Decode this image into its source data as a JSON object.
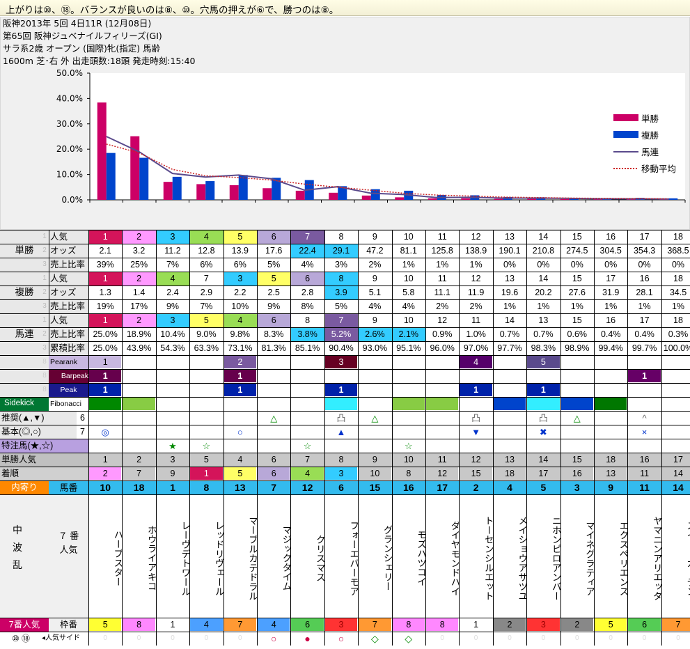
{
  "top_message": "上がりは⑩、⑱。バランスが良いのは⑧、⑩。穴馬の押えが⑥で、勝つのは⑧。",
  "race": {
    "line1": "阪神2013年 5回 4日11R (12月08日)",
    "line2": "第65回 阪神ジュベナイルフィリーズ(GI)",
    "line3": "サラ系2歳 オープン (国際)牝(指定) 馬齢",
    "line4": "1600m 芝･右 外 出走頭数:18頭 発走時刻:15:40"
  },
  "chart_data": {
    "type": "bar",
    "categories": [
      "1",
      "2",
      "3",
      "4",
      "5",
      "6",
      "7",
      "8",
      "9",
      "10",
      "11",
      "12",
      "13",
      "14",
      "15",
      "16",
      "17",
      "18"
    ],
    "ylim": [
      0,
      50
    ],
    "yticks": [
      "0.0%",
      "10.0%",
      "20.0%",
      "30.0%",
      "40.0%",
      "50.0%"
    ],
    "series": [
      {
        "name": "単勝",
        "type": "bar",
        "color": "#cc0066",
        "values": [
          38.4,
          25.1,
          7.1,
          6.2,
          5.8,
          4.6,
          3.6,
          2.8,
          1.7,
          1.0,
          0.6,
          0.6,
          0.4,
          0.4,
          0.3,
          0.3,
          0.2,
          0.2
        ]
      },
      {
        "name": "複勝",
        "type": "bar",
        "color": "#0044cc",
        "values": [
          18.5,
          16.6,
          9.1,
          7.4,
          9.8,
          8.7,
          7.8,
          5.4,
          4.2,
          3.6,
          1.9,
          1.8,
          1.1,
          1.0,
          0.8,
          0.7,
          0.8,
          0.6
        ]
      },
      {
        "name": "馬連",
        "type": "line",
        "color": "#5a4a8c",
        "values": [
          25.0,
          18.9,
          10.4,
          9.0,
          9.8,
          8.3,
          3.8,
          5.2,
          2.6,
          2.1,
          0.9,
          1.0,
          0.7,
          0.7,
          0.6,
          0.4,
          0.4,
          0.3
        ]
      },
      {
        "name": "移動平均",
        "type": "dotted",
        "color": "#cc2222",
        "values": [
          22.0,
          18.5,
          12.0,
          9.5,
          8.8,
          7.8,
          6.2,
          5.0,
          3.8,
          2.6,
          1.9,
          1.5,
          1.1,
          0.9,
          0.7,
          0.6,
          0.5,
          0.4
        ]
      }
    ]
  },
  "headers": {
    "tansho": "単勝",
    "fukusho": "複勝",
    "umaren": "馬連",
    "ninki": "人気",
    "odds": "オッズ",
    "uriage": "売上比率",
    "ruiseki": "累積比率",
    "pearank": "Pearank",
    "barpeak": "Barpeak",
    "peak": "Peak",
    "sidekick": "Sidekick",
    "fibonacci": "Fibonacci",
    "suisen": "推奨(▲,▼)",
    "suisen_n": "6",
    "kihon": "基本(◎,○)",
    "kihon_n": "7",
    "tokuchu": "特注馬(★,☆)",
    "tansho_ninki": "単勝人気",
    "chakujun": "着順",
    "uchiyori": "内寄り",
    "umaban": "馬番",
    "pattern1": "中",
    "pattern2": "波",
    "pattern3": "乱",
    "pattern_sub1": "７ 番",
    "pattern_sub2": "人気",
    "footer_left": "7番人気",
    "wakuban": "枠番",
    "popular_side_marks": "⑩ ⑱",
    "popular_side": "◂人気サイド",
    "row_fade1": "1",
    "row_fade2": "2",
    "row_fade3": "3"
  },
  "colors": {
    "magenta": "#d4145a",
    "pink": "#ff99ff",
    "cyan": "#33ccff",
    "green": "#99dd55",
    "yellow": "#ffff66",
    "lavender": "#b8a8d8",
    "purple": "#7a5aa0",
    "orange": "#ff9933",
    "darkpurple": "#66004c",
    "navy": "#0a1a8c",
    "blue": "#0033cc"
  },
  "tansho": {
    "ninki": [
      "1",
      "2",
      "3",
      "4",
      "5",
      "6",
      "7",
      "8",
      "9",
      "10",
      "11",
      "12",
      "13",
      "14",
      "15",
      "16",
      "17",
      "18"
    ],
    "odds": [
      "2.1",
      "3.2",
      "11.2",
      "12.8",
      "13.9",
      "17.6",
      "22.4",
      "29.1",
      "47.2",
      "81.1",
      "125.8",
      "138.9",
      "190.1",
      "210.8",
      "274.5",
      "304.5",
      "354.3",
      "368.5"
    ],
    "ratio": [
      "39%",
      "25%",
      "7%",
      "6%",
      "6%",
      "5%",
      "4%",
      "3%",
      "2%",
      "1%",
      "1%",
      "1%",
      "0%",
      "0%",
      "0%",
      "0%",
      "0%",
      "0%"
    ]
  },
  "fukusho": {
    "ninki": [
      "1",
      "2",
      "4",
      "7",
      "3",
      "5",
      "6",
      "8",
      "9",
      "10",
      "11",
      "12",
      "13",
      "14",
      "15",
      "17",
      "16",
      "18"
    ],
    "odds": [
      "1.3",
      "1.4",
      "2.4",
      "2.9",
      "2.2",
      "2.5",
      "2.8",
      "3.9",
      "5.1",
      "5.8",
      "11.1",
      "11.9",
      "19.6",
      "20.2",
      "27.6",
      "31.9",
      "28.1",
      "34.5"
    ],
    "ratio": [
      "19%",
      "17%",
      "9%",
      "7%",
      "10%",
      "9%",
      "8%",
      "5%",
      "4%",
      "4%",
      "2%",
      "2%",
      "1%",
      "1%",
      "1%",
      "1%",
      "1%",
      "1%"
    ]
  },
  "umaren": {
    "ninki": [
      "1",
      "2",
      "3",
      "5",
      "4",
      "6",
      "8",
      "7",
      "9",
      "10",
      "12",
      "11",
      "14",
      "13",
      "15",
      "16",
      "17",
      "18"
    ],
    "ratio": [
      "25.0%",
      "18.9%",
      "10.4%",
      "9.0%",
      "9.8%",
      "8.3%",
      "3.8%",
      "5.2%",
      "2.6%",
      "2.1%",
      "0.9%",
      "1.0%",
      "0.7%",
      "0.7%",
      "0.6%",
      "0.4%",
      "0.4%",
      "0.3%"
    ],
    "cumulative": [
      "25.0%",
      "43.9%",
      "54.3%",
      "63.3%",
      "73.1%",
      "81.3%",
      "85.1%",
      "90.4%",
      "93.0%",
      "95.1%",
      "96.0%",
      "97.0%",
      "97.7%",
      "98.3%",
      "98.9%",
      "99.4%",
      "99.7%",
      "100.0%"
    ]
  },
  "indicators": {
    "pearank": [
      "1",
      "",
      "",
      "",
      "2",
      "",
      "",
      "3",
      "",
      "",
      "",
      "4",
      "",
      "5",
      "",
      "",
      "",
      ""
    ],
    "barpeak": [
      "1",
      "",
      "",
      "",
      "1",
      "",
      "",
      "",
      "",
      "",
      "",
      "",
      "",
      "",
      "",
      "",
      "1",
      ""
    ],
    "peak": [
      "1",
      "",
      "",
      "",
      "1",
      "",
      "",
      "1",
      "",
      "",
      "",
      "1",
      "",
      "1",
      "",
      "",
      "",
      ""
    ]
  },
  "marks": {
    "suisen": [
      "",
      "",
      "",
      "",
      "",
      "△",
      "",
      "凸",
      "△",
      "",
      "",
      "凸",
      "",
      "凸",
      "△",
      "",
      "^",
      ""
    ],
    "kihon": [
      "◎",
      "",
      "",
      "",
      "○",
      "",
      "",
      "▲",
      "",
      "",
      "",
      "▼",
      "",
      "✖",
      "",
      "",
      "×",
      ""
    ],
    "tokuchu": [
      "",
      "",
      "★",
      "☆",
      "",
      "",
      "☆",
      "",
      "",
      "☆",
      "",
      "",
      "",
      "",
      "",
      "",
      "",
      ""
    ]
  },
  "tansho_ninki": [
    "1",
    "2",
    "3",
    "5",
    "4",
    "6",
    "7",
    "8",
    "9",
    "10",
    "11",
    "12",
    "13",
    "14",
    "15",
    "18",
    "16",
    "17"
  ],
  "chakujun": [
    "2",
    "7",
    "9",
    "1",
    "5",
    "6",
    "4",
    "3",
    "10",
    "8",
    "12",
    "15",
    "18",
    "17",
    "16",
    "13",
    "11",
    "14"
  ],
  "umaban": [
    "10",
    "18",
    "1",
    "8",
    "13",
    "7",
    "12",
    "6",
    "15",
    "16",
    "17",
    "2",
    "4",
    "5",
    "3",
    "9",
    "11",
    "14"
  ],
  "horses": [
    "ハープスター",
    "ホウライアキコ",
    "レーヴデトワール",
    "レッドリヴェール",
    "マーブルカテドラル",
    "マジックタイム",
    "クリスマス",
    "フォーエバーモア",
    "グランシェリー",
    "モズハツコイ",
    "ダイヤモンドハイ",
    "トーセンシルエット",
    "メイショウアサツユ",
    "ニホンピロアンバー",
    "マイネグラティア",
    "エクスペリエンス",
    "ヤマニンアリエッタ",
    "スイートガーデン"
  ],
  "wakuban": [
    "5",
    "8",
    "1",
    "4",
    "7",
    "4",
    "6",
    "3",
    "7",
    "8",
    "8",
    "1",
    "2",
    "3",
    "2",
    "5",
    "6",
    "7"
  ],
  "popular_side": [
    "",
    "",
    "",
    "",
    "",
    "○",
    "●",
    "○",
    "◇",
    "◇",
    "",
    "",
    "",
    "",
    "",
    "",
    "",
    ""
  ],
  "faint_zero": "0"
}
